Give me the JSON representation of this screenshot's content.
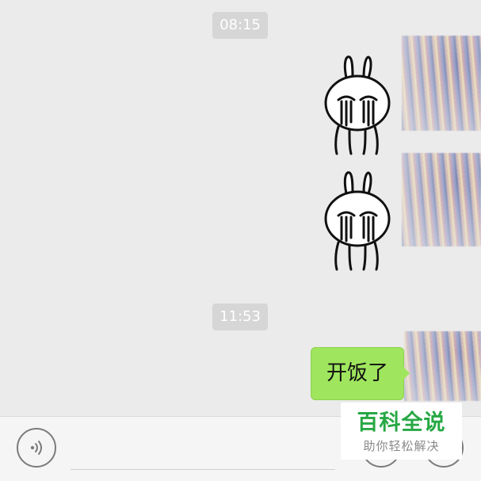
{
  "chat": {
    "timestamps": [
      "08:15",
      "11:53"
    ],
    "messages": [
      {
        "type": "sticker",
        "sticker": "crying-rabbit-sticker"
      },
      {
        "type": "sticker",
        "sticker": "crying-rabbit-sticker"
      },
      {
        "type": "text",
        "text": "开饭了"
      }
    ],
    "bubble_color": "#9fe65e"
  },
  "input_bar": {
    "voice_icon": "voice-icon",
    "emoji_icon": "emoji-icon",
    "plus_icon": "plus-icon"
  },
  "watermark": {
    "title": "百科全说",
    "subtitle": "助你轻松解决",
    "color": "#27a844"
  }
}
